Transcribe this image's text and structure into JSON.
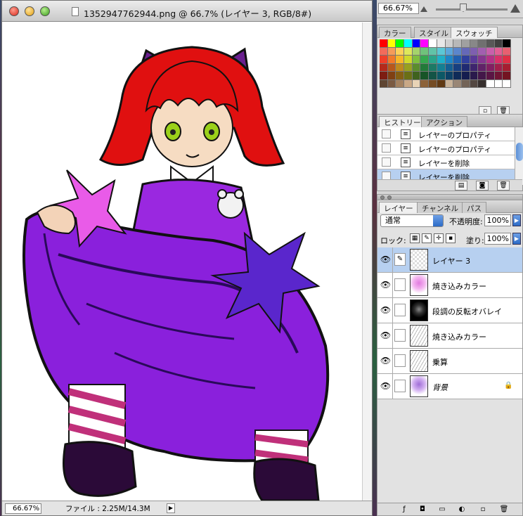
{
  "document": {
    "title": "1352947762944.png @ 66.7% (レイヤー 3, RGB/8#)",
    "status_zoom": "66.67%",
    "file_info": "ファイル : 2.25M/14.3M"
  },
  "navigator": {
    "zoom": "66.67%"
  },
  "swatches": {
    "tabs": [
      "カラー",
      "スタイル",
      "スウォッチ"
    ],
    "active_tab": "スウォッチ",
    "colors": [
      "#ff0000",
      "#ffff00",
      "#00ff00",
      "#00ffff",
      "#0000ff",
      "#ff00ff",
      "#ffffff",
      "#e8e8e8",
      "#d0d0d0",
      "#b8b8b8",
      "#a0a0a0",
      "#888888",
      "#707070",
      "#585858",
      "#404040",
      "#000000",
      "#f26b5b",
      "#f59b5a",
      "#fbd15a",
      "#dfe85b",
      "#a5d46b",
      "#6fc27b",
      "#61c3a8",
      "#5bc7d6",
      "#5aa6dc",
      "#5b86cc",
      "#6568b8",
      "#7e5fb0",
      "#a25fb0",
      "#c95fac",
      "#e35f95",
      "#e86070",
      "#ee3f2a",
      "#f27a2a",
      "#f7b72a",
      "#cfd92c",
      "#7fbf3f",
      "#35a84f",
      "#2ba58a",
      "#1fb0c8",
      "#1e86c8",
      "#2160b0",
      "#31409e",
      "#5a3a98",
      "#86368f",
      "#b43187",
      "#d93069",
      "#df3046",
      "#b52a1b",
      "#b8581b",
      "#bf8a1c",
      "#98a01f",
      "#5b8d2c",
      "#227a39",
      "#1c7a65",
      "#137f93",
      "#135f93",
      "#173f80",
      "#1f2a72",
      "#3e256e",
      "#612268",
      "#821f62",
      "#a11e4b",
      "#a61e30",
      "#7d1d12",
      "#804012",
      "#855f13",
      "#6a6f15",
      "#3f621e",
      "#175427",
      "#135446",
      "#0c5866",
      "#0c4166",
      "#0f2b58",
      "#151d4f",
      "#2a1a4c",
      "#431749",
      "#5a1544",
      "#701434",
      "#731421",
      "#5f4532",
      "#7a5a42",
      "#a38160",
      "#c9a886",
      "#e8d3b6",
      "#8c6239",
      "#754c24",
      "#603913",
      "#c7b299",
      "#998675",
      "#736357",
      "#534741",
      "#362f2d",
      "#ffffff",
      "#ffffff",
      "#ffffff"
    ]
  },
  "history": {
    "tabs": [
      "ヒストリー",
      "アクション"
    ],
    "active_tab": "ヒストリー",
    "items": [
      {
        "label": "レイヤーのプロパティ",
        "selected": false
      },
      {
        "label": "レイヤーのプロパティ",
        "selected": false
      },
      {
        "label": "レイヤーを削除",
        "selected": false
      },
      {
        "label": "レイヤーを削除",
        "selected": true
      }
    ]
  },
  "layers": {
    "tabs": [
      "レイヤー",
      "チャンネル",
      "パス"
    ],
    "active_tab": "レイヤー",
    "blend_mode": "通常",
    "opacity_label": "不透明度:",
    "opacity": "100%",
    "lock_label": "ロック:",
    "fill_label": "塗り:",
    "fill": "100%",
    "items": [
      {
        "name": "レイヤー 3",
        "thumb": "t-check",
        "selected": true,
        "brush": true,
        "locked": false,
        "italic": false
      },
      {
        "name": "焼き込みカラー",
        "thumb": "t-pink",
        "selected": false,
        "brush": false,
        "locked": false,
        "italic": false
      },
      {
        "name": "段調の反転オバレイ",
        "thumb": "t-black",
        "selected": false,
        "brush": false,
        "locked": false,
        "italic": false
      },
      {
        "name": "焼き込みカラー",
        "thumb": "t-sketch",
        "selected": false,
        "brush": false,
        "locked": false,
        "italic": false
      },
      {
        "name": "乗算",
        "thumb": "t-sketch",
        "selected": false,
        "brush": false,
        "locked": false,
        "italic": false
      },
      {
        "name": "背景",
        "thumb": "t-bg",
        "selected": false,
        "brush": false,
        "locked": true,
        "italic": true
      }
    ]
  }
}
